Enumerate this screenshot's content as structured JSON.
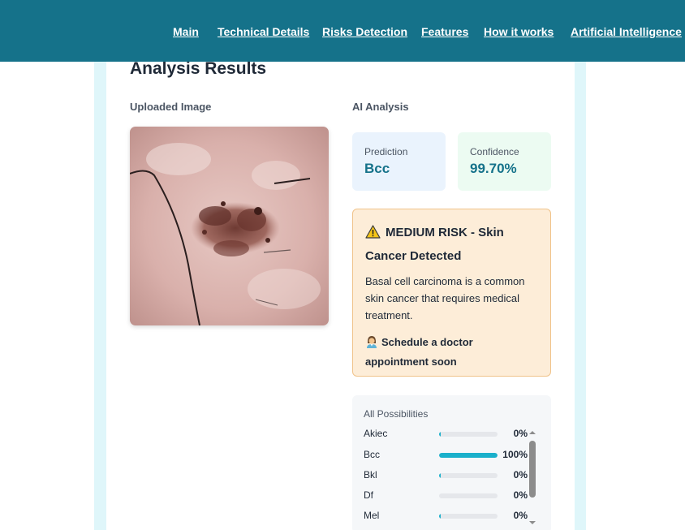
{
  "nav": {
    "items": [
      {
        "label": "Main"
      },
      {
        "label": "Technical Details"
      },
      {
        "label": "Risks Detection"
      },
      {
        "label": "Features"
      },
      {
        "label": "How it works"
      },
      {
        "label": "Artificial Intelligence"
      }
    ]
  },
  "results": {
    "title": "Analysis Results",
    "uploaded_label": "Uploaded Image",
    "ai_label": "AI Analysis"
  },
  "prediction": {
    "label": "Prediction",
    "value": "Bcc"
  },
  "confidence": {
    "label": "Confidence",
    "value": "99.70%"
  },
  "risk": {
    "title": "MEDIUM RISK - Skin Cancer Detected",
    "description": "Basal cell carcinoma is a common skin cancer that requires medical treatment.",
    "action": "Schedule a doctor appointment soon"
  },
  "possibilities": {
    "title": "All Possibilities",
    "rows": [
      {
        "name": "Akiec",
        "value": "0%",
        "fraction": 0
      },
      {
        "name": "Bcc",
        "value": "100%",
        "fraction": 1
      },
      {
        "name": "Bkl",
        "value": "0%",
        "fraction": 0
      },
      {
        "name": "Df",
        "value": "0%",
        "fraction": 0
      },
      {
        "name": "Mel",
        "value": "0%",
        "fraction": 0
      }
    ]
  },
  "colors": {
    "header": "#15728a",
    "accent": "#1ab0cb",
    "risk_bg": "#fdedd8",
    "prediction_bg": "#eaf3fd",
    "confidence_bg": "#ecfbf2"
  },
  "icons": {
    "risk": "warning-icon",
    "action": "doctor-icon",
    "scroll_up": "chevron-up-icon",
    "scroll_down": "chevron-down-icon"
  }
}
